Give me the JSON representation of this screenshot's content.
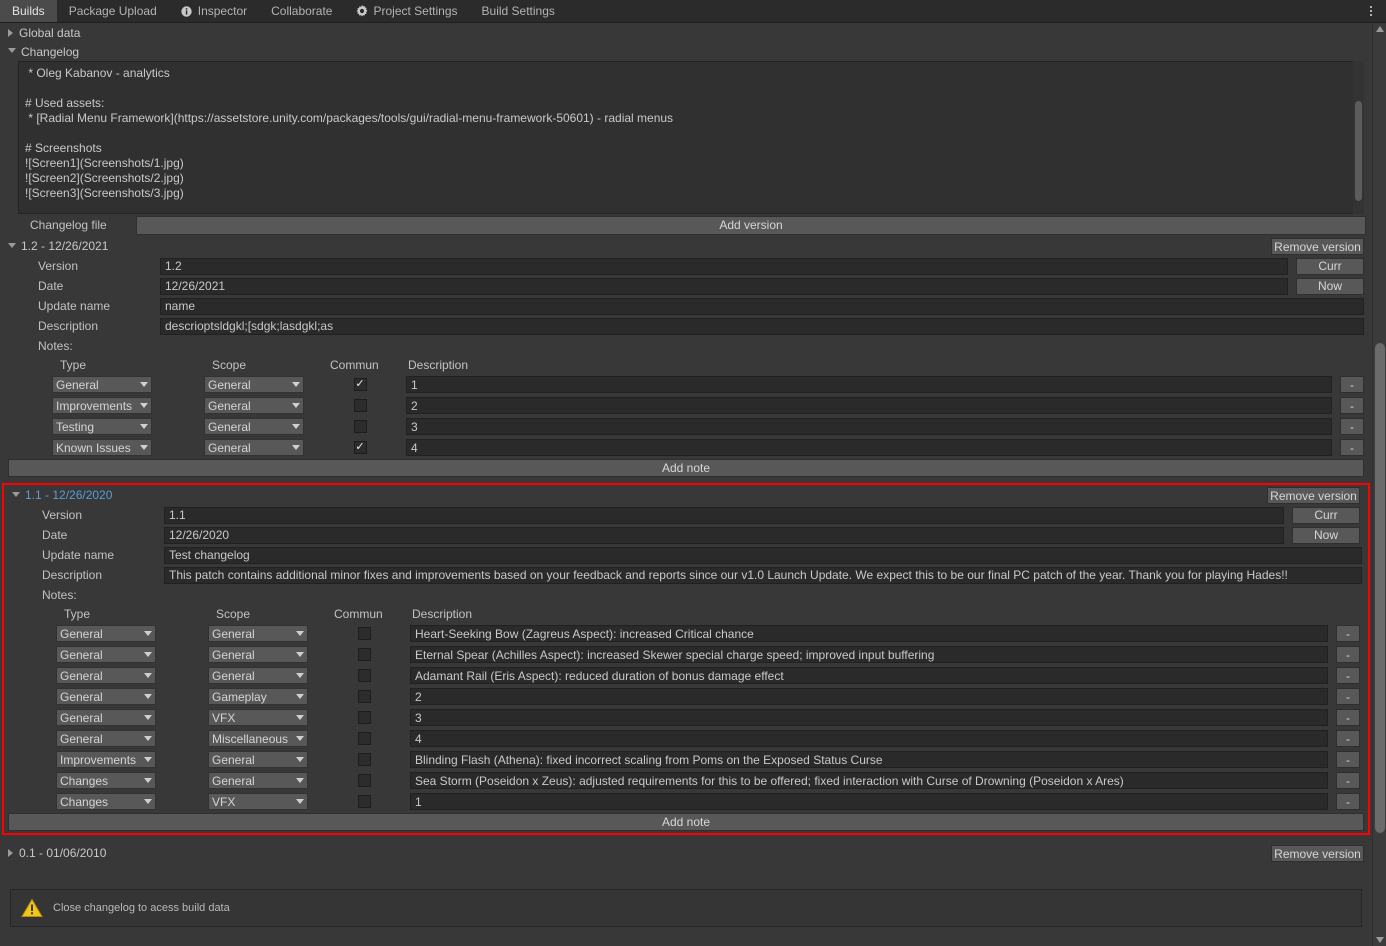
{
  "tabs": [
    {
      "label": "Builds",
      "icon": null,
      "active": true
    },
    {
      "label": "Package Upload",
      "icon": null,
      "active": false
    },
    {
      "label": "Inspector",
      "icon": "info-icon",
      "active": false
    },
    {
      "label": "Collaborate",
      "icon": null,
      "active": false
    },
    {
      "label": "Project Settings",
      "icon": "gear-icon",
      "active": false
    },
    {
      "label": "Build Settings",
      "icon": null,
      "active": false
    }
  ],
  "foldouts": {
    "global_data": "Global data",
    "changelog": "Changelog"
  },
  "changelog_text": " * Oleg Kabanov - analytics\n\n# Used assets:\n * [Radial Menu Framework](https://assetstore.unity.com/packages/tools/gui/radial-menu-framework-50601) - radial menus\n\n# Screenshots\n![Screen1](Screenshots/1.jpg)\n![Screen2](Screenshots/2.jpg)\n![Screen3](Screenshots/3.jpg)",
  "changelog_file": {
    "label": "Changelog file",
    "value": ""
  },
  "add_version_label": "Add version",
  "add_note_label": "Add note",
  "remove_version_label": "Remove version",
  "curr_label": "Curr",
  "now_label": "Now",
  "minus_label": "-",
  "field_labels": {
    "version": "Version",
    "date": "Date",
    "update_name": "Update name",
    "description": "Description",
    "notes": "Notes:"
  },
  "notes_columns": {
    "type": "Type",
    "scope": "Scope",
    "commun": "Commun",
    "description": "Description"
  },
  "versions": [
    {
      "header": "1.2 - 12/26/2021",
      "expanded": true,
      "selected": false,
      "version": "1.2",
      "date": "12/26/2021",
      "update_name": "name",
      "description": "descrioptsldgkl;[sdgk;lasdgkl;as",
      "notes": [
        {
          "type": "General",
          "scope": "General",
          "commun": true,
          "description": "1"
        },
        {
          "type": "Improvements",
          "scope": "General",
          "commun": false,
          "description": "2"
        },
        {
          "type": "Testing",
          "scope": "General",
          "commun": false,
          "description": "3"
        },
        {
          "type": "Known Issues",
          "scope": "General",
          "commun": true,
          "description": "4"
        }
      ]
    },
    {
      "header": "1.1 - 12/26/2020",
      "expanded": true,
      "selected": true,
      "version": "1.1",
      "date": "12/26/2020",
      "update_name": "Test changelog",
      "description": "This patch contains additional minor fixes and improvements based on your feedback and reports since our v1.0 Launch Update. We expect this to be our final PC patch of the year. Thank you for playing Hades!!",
      "notes": [
        {
          "type": "General",
          "scope": "General",
          "commun": false,
          "description": "Heart-Seeking Bow (Zagreus Aspect): increased Critical chance"
        },
        {
          "type": "General",
          "scope": "General",
          "commun": false,
          "description": "Eternal Spear (Achilles Aspect): increased Skewer special charge speed; improved input buffering"
        },
        {
          "type": "General",
          "scope": "General",
          "commun": false,
          "description": "Adamant Rail (Eris Aspect): reduced duration of bonus damage effect"
        },
        {
          "type": "General",
          "scope": "Gameplay",
          "commun": false,
          "description": "2"
        },
        {
          "type": "General",
          "scope": "VFX",
          "commun": false,
          "description": "3"
        },
        {
          "type": "General",
          "scope": "Miscellaneous",
          "commun": false,
          "description": "4"
        },
        {
          "type": "Improvements",
          "scope": "General",
          "commun": false,
          "description": "Blinding Flash (Athena): fixed incorrect scaling from Poms on the Exposed Status Curse"
        },
        {
          "type": "Changes",
          "scope": "General",
          "commun": false,
          "description": "Sea Storm (Poseidon x Zeus): adjusted requirements for this to be offered; fixed interaction with Curse of Drowning (Poseidon x Ares)"
        },
        {
          "type": "Changes",
          "scope": "VFX",
          "commun": false,
          "description": "1"
        }
      ]
    },
    {
      "header": "0.1 - 01/06/2010",
      "expanded": false,
      "selected": false,
      "version": "0.1",
      "date": "01/06/2010",
      "update_name": "",
      "description": "",
      "notes": []
    }
  ],
  "warning": {
    "text": "Close changelog to acess build data",
    "icon": "warning-triangle-icon"
  },
  "colors": {
    "selection_outline": "#ff0000",
    "selected_version_text": "#5b9bd5",
    "background": "#383838",
    "warning_yellow": "#f5c518"
  }
}
